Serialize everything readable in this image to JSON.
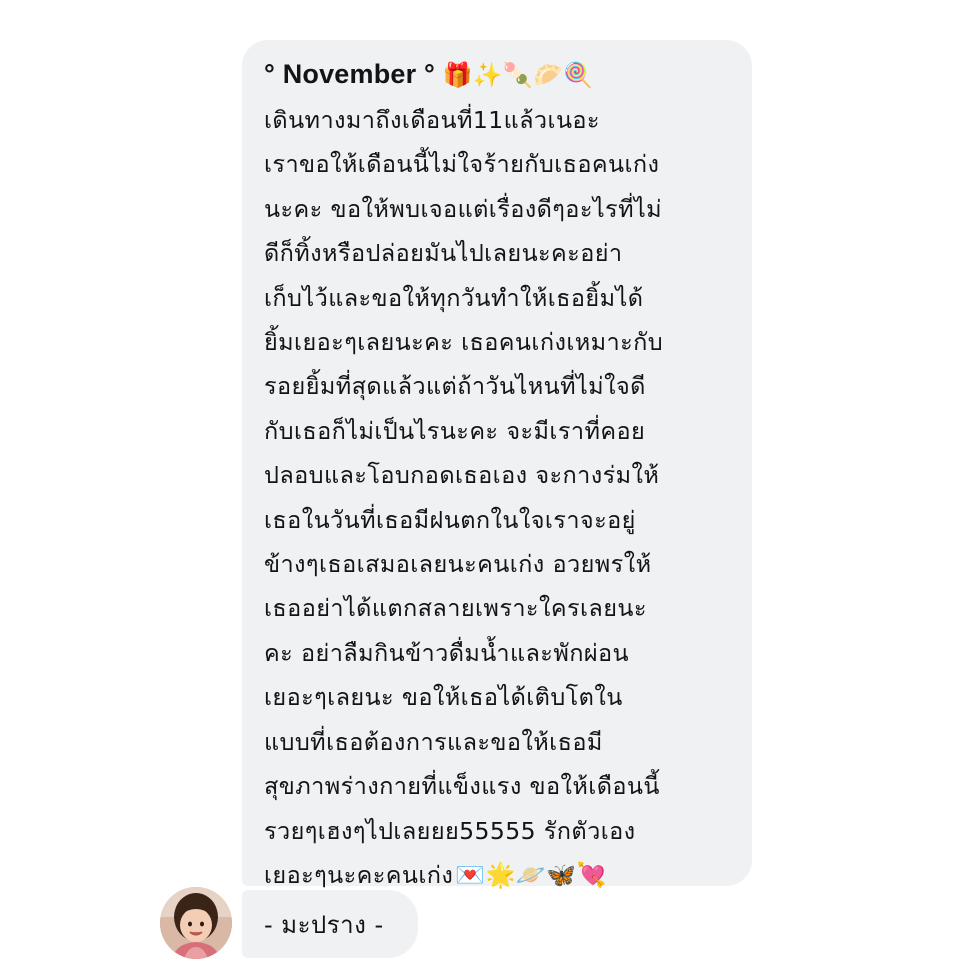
{
  "message": {
    "title": "° November °",
    "title_emojis": "🎁✨🍡🥟🍭",
    "lines": [
      "เดินทางมาถึงเดือนที่11แล้วเนอะ",
      "เราขอให้เดือนนี้ไม่ใจร้ายกับเธอคนเก่ง",
      "นะคะ ขอให้พบเจอแต่เรื่องดีๆอะไรที่ไม่",
      "ดีก็ทิ้งหรือปล่อยมันไปเลยนะคะอย่า",
      "เก็บไว้และขอให้ทุกวันทำให้เธอยิ้มได้",
      "ยิ้มเยอะๆเลยนะคะ เธอคนเก่งเหมาะกับ",
      "รอยยิ้มที่สุดแล้วแต่ถ้าวันไหนที่ไม่ใจดี",
      "กับเธอก็ไม่เป็นไรนะคะ จะมีเราที่คอย",
      "ปลอบและโอบกอดเธอเอง จะกางร่มให้",
      "เธอในวันที่เธอมีฝนตกในใจเราจะอยู่",
      "ข้างๆเธอเสมอเลยนะคนเก่ง อวยพรให้",
      "เธออย่าได้แตกสลายเพราะใครเลยนะ",
      "คะ อย่าลืมกินข้าวดื่มน้ำและพักผ่อน",
      "เยอะๆเลยนะ ขอให้เธอได้เติบโตใน",
      "แบบที่เธอต้องการและขอให้เธอมี",
      "สุขภาพร่างกายที่แข็งแรง ขอให้เดือนนี้",
      "รวยๆเฮงๆไปเลยยย55555 รักตัวเอง"
    ],
    "last_line": "เยอะๆนะคะคนเก่ง",
    "last_line_emojis": "💌🌟🪐🦋💘"
  },
  "signature": {
    "text": "- มะปราง -"
  },
  "avatar": {
    "icon": "child-avatar-icon"
  },
  "colors": {
    "bubble": "#eff1f3",
    "text": "#141414",
    "background": "#ffffff"
  }
}
